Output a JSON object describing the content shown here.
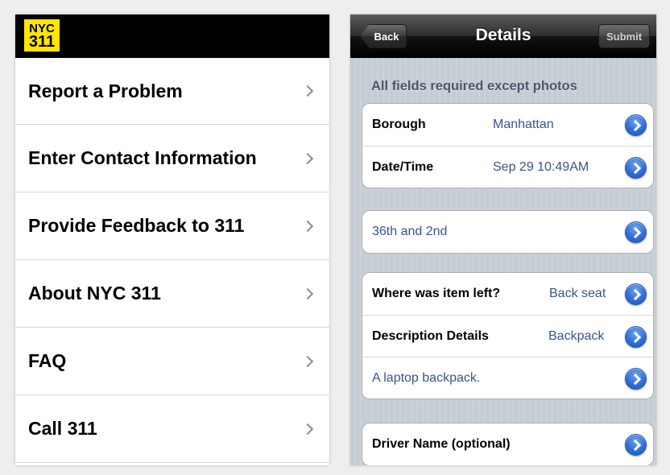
{
  "left": {
    "logo": {
      "top": "NYC",
      "bottom": "311",
      "color": "#ffe500"
    },
    "menu": [
      {
        "label": "Report a Problem"
      },
      {
        "label": "Enter Contact Information"
      },
      {
        "label": "Provide Feedback to 311"
      },
      {
        "label": "About NYC 311"
      },
      {
        "label": "FAQ"
      },
      {
        "label": "Call 311"
      }
    ]
  },
  "right": {
    "nav": {
      "back_label": "Back",
      "title": "Details",
      "submit_label": "Submit"
    },
    "section_header": "All fields required except photos",
    "group1": [
      {
        "label": "Borough",
        "value": "Manhattan"
      },
      {
        "label": "Date/Time",
        "value": "Sep 29 10:49AM"
      }
    ],
    "group2": [
      {
        "text": "36th and 2nd"
      }
    ],
    "group3": [
      {
        "label": "Where was item left?",
        "value": "Back seat"
      },
      {
        "label": "Description Details",
        "value": "Backpack"
      },
      {
        "text": "A laptop backpack."
      }
    ],
    "group4": [
      {
        "label": "Driver Name (optional)"
      }
    ],
    "colors": {
      "value_text": "#385487",
      "disclosure": "#2f6fd8"
    }
  }
}
